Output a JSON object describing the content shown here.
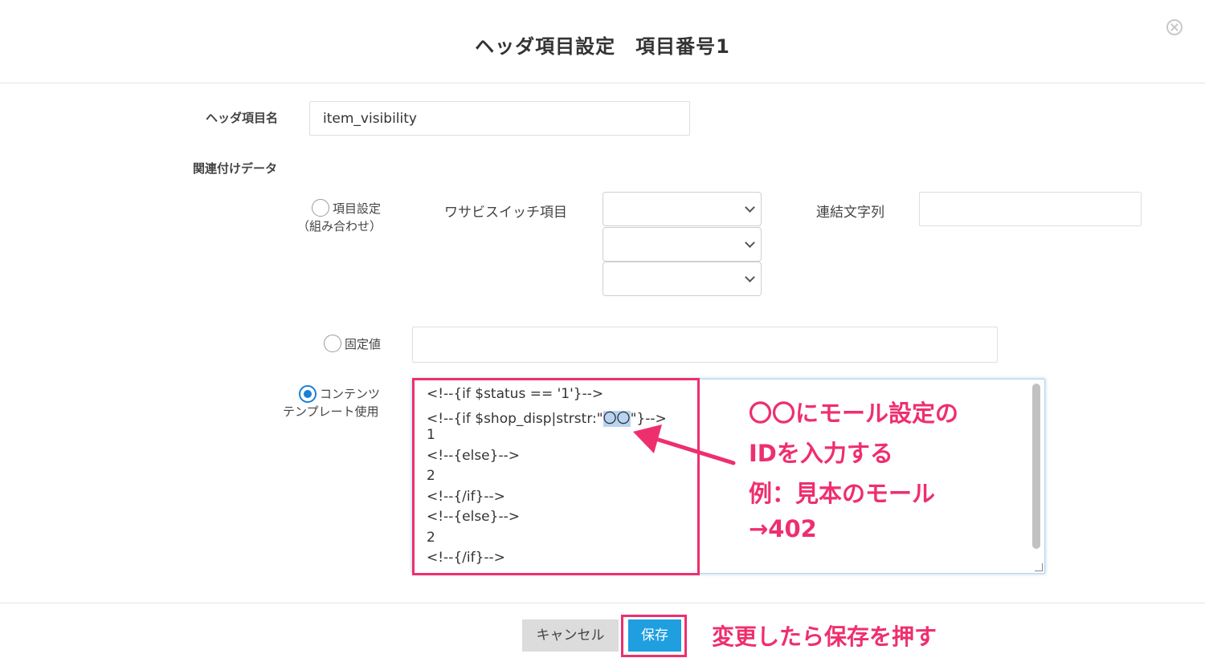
{
  "dialog": {
    "title": "ヘッダ項目設定　項目番号1"
  },
  "form": {
    "header_name_label": "ヘッダ項目名",
    "header_name_value": "item_visibility",
    "related_data_label": "関連付けデータ",
    "option_combo": {
      "label_line1": "項目設定",
      "label_line2": "（組み合わせ）",
      "switch_label": "ワサビスイッチ項目",
      "join_label": "連結文字列",
      "join_value": "",
      "selects": [
        "",
        "",
        ""
      ]
    },
    "option_fixed": {
      "label": "固定値",
      "value": ""
    },
    "option_template": {
      "label_line1": "コンテンツ",
      "label_line2": "テンプレート使用",
      "selected": true,
      "code_lines": [
        "<!--{if $status == '1'}-->",
        "<!--{if $shop_disp|strstr:\"",
        "1",
        "<!--{else}-->",
        "2",
        "<!--{/if}-->",
        "<!--{else}-->",
        "2",
        "<!--{/if}-->"
      ],
      "code_line2_highlight": "〇〇",
      "code_line2_tail": "\"}-->"
    }
  },
  "annotations": {
    "template": [
      "〇〇にモール設定の",
      "IDを入力する",
      "例：見本のモール",
      "→402"
    ],
    "save": "変更したら保存を押す",
    "color": "#ee2f6e"
  },
  "footer": {
    "cancel_label": "キャンセル",
    "save_label": "保存"
  },
  "colors": {
    "accent": "#1f9fe0",
    "radio_selected": "#1a7fd6",
    "annotation": "#ee2f6e"
  },
  "icons": {
    "close": "close-circle-icon",
    "select": "chevron-down-icon",
    "annotation_arrow": "arrow-icon"
  }
}
